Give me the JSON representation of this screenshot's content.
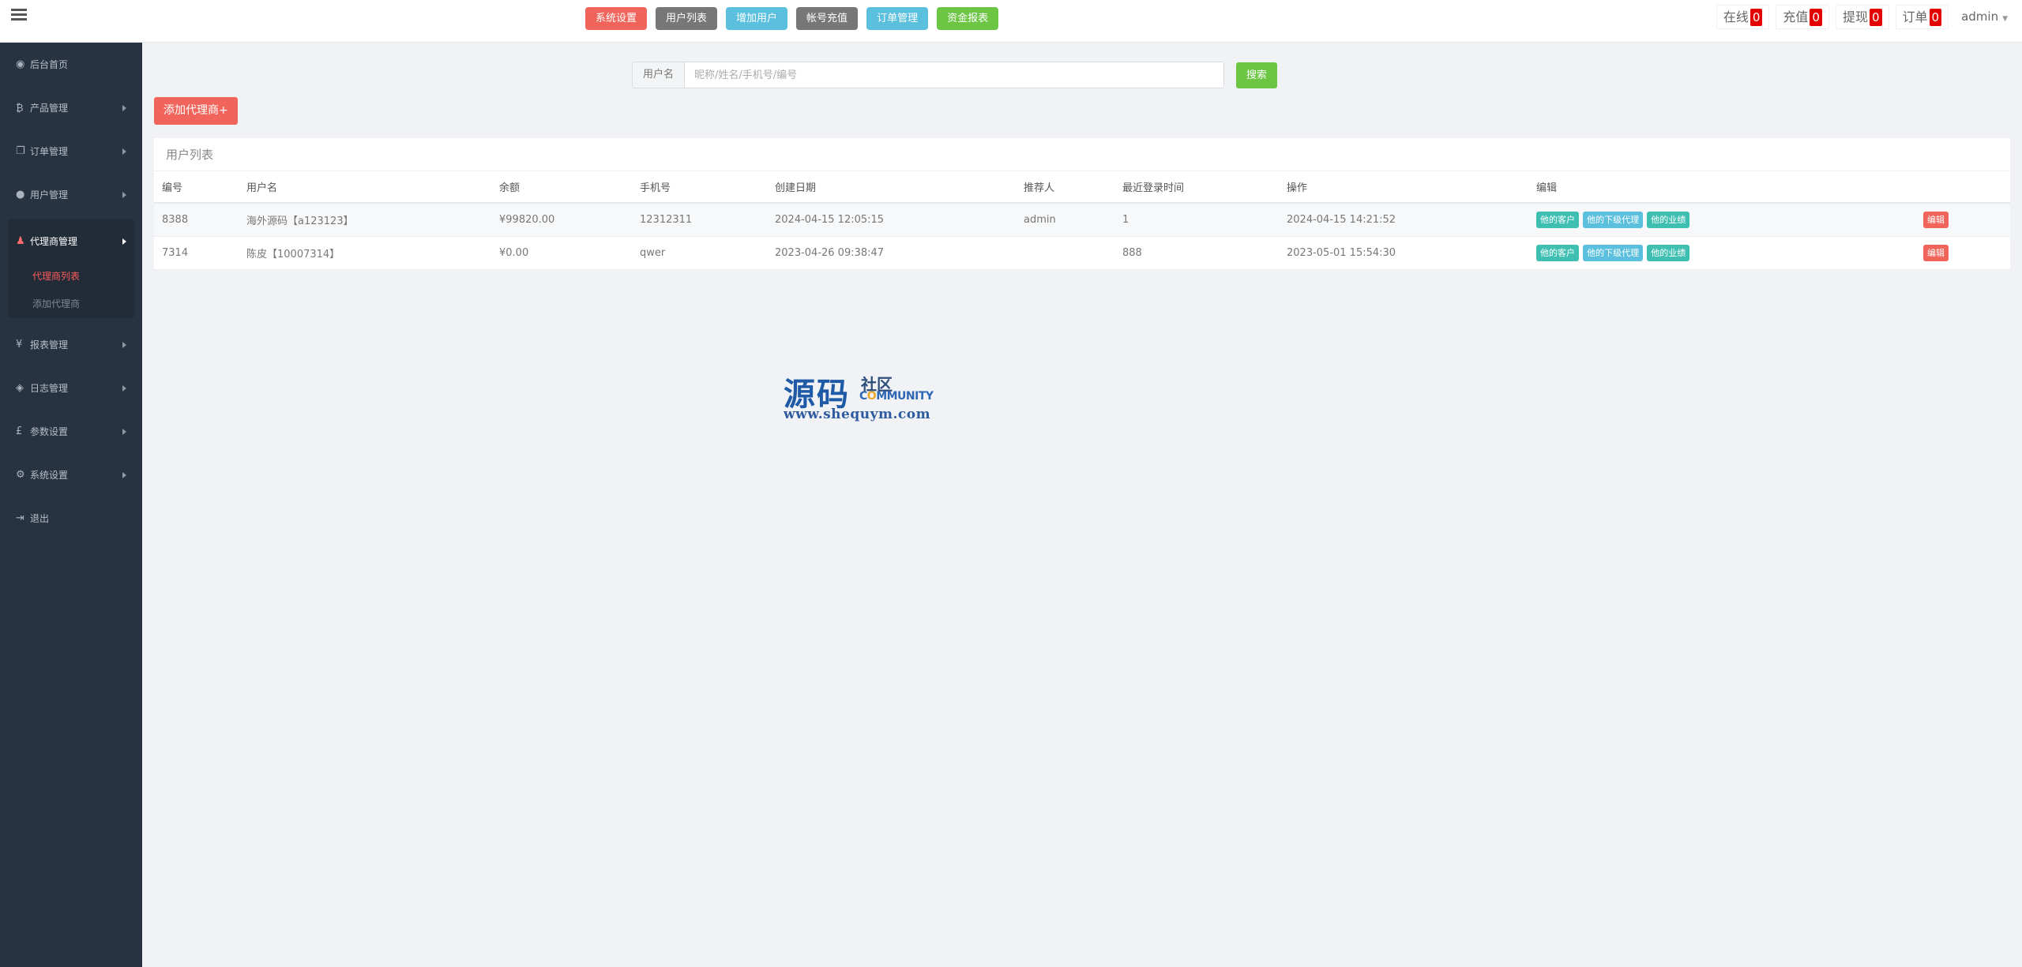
{
  "topbar": {
    "quick_buttons": [
      {
        "label": "系统设置",
        "color": "#f0645b"
      },
      {
        "label": "用户列表",
        "color": "#777777"
      },
      {
        "label": "增加用户",
        "color": "#5bc0de"
      },
      {
        "label": "帐号充值",
        "color": "#777777"
      },
      {
        "label": "订单管理",
        "color": "#5bc0de"
      },
      {
        "label": "资金报表",
        "color": "#6cc644"
      }
    ],
    "stats": [
      {
        "label": "在线",
        "count": "0"
      },
      {
        "label": "充值",
        "count": "0"
      },
      {
        "label": "提现",
        "count": "0"
      },
      {
        "label": "订单",
        "count": "0"
      }
    ],
    "user": "admin"
  },
  "sidebar": {
    "items": [
      {
        "label": "后台首页",
        "icon": "dashboard-icon",
        "glyph": "◉"
      },
      {
        "label": "产品管理",
        "icon": "bitcoin-icon",
        "glyph": "₿"
      },
      {
        "label": "订单管理",
        "icon": "copy-icon",
        "glyph": "❐"
      },
      {
        "label": "用户管理",
        "icon": "user-icon",
        "glyph": "●"
      },
      {
        "label": "代理商管理",
        "icon": "sitemap-icon",
        "glyph": "♟"
      },
      {
        "label": "报表管理",
        "icon": "yen-icon",
        "glyph": "¥"
      },
      {
        "label": "日志管理",
        "icon": "ticket-icon",
        "glyph": "◈"
      },
      {
        "label": "参数设置",
        "icon": "pound-icon",
        "glyph": "£"
      },
      {
        "label": "系统设置",
        "icon": "gears-icon",
        "glyph": "⚙"
      },
      {
        "label": "退出",
        "icon": "sign-out-icon",
        "glyph": "⇥"
      }
    ],
    "sub_items": [
      "代理商列表",
      "添加代理商"
    ]
  },
  "search": {
    "label": "用户名",
    "placeholder": "昵称/姓名/手机号/编号",
    "button": "搜索"
  },
  "add_agent_button": "添加代理商+",
  "panel": {
    "title": "用户列表",
    "columns": [
      "编号",
      "用户名",
      "余额",
      "手机号",
      "创建日期",
      "推荐人",
      "最近登录时间",
      "操作",
      "编辑"
    ],
    "rows": [
      {
        "id": "8388",
        "username": "海外源码【a123123】",
        "balance": "¥99820.00",
        "phone": "12312311",
        "created": "2024-04-15 12:05:15",
        "referrer": "admin",
        "last_login": "1",
        "operation": "2024-04-15 14:21:52",
        "actions": [
          "他的客户",
          "他的下级代理",
          "他的业绩"
        ],
        "edit": "编辑"
      },
      {
        "id": "7314",
        "username": "陈皮【10007314】",
        "balance": "¥0.00",
        "phone": "qwer",
        "created": "2023-04-26 09:38:47",
        "referrer": "",
        "last_login": "888",
        "operation": "2023-05-01 15:54:30",
        "actions": [
          "他的客户",
          "他的下级代理",
          "他的业绩"
        ],
        "edit": "编辑"
      }
    ]
  },
  "watermark": {
    "big": "源码",
    "small": "社区",
    "english_1": "C",
    "english_o": "O",
    "english_2": "MMUNITY",
    "url": "www.shequym.com"
  }
}
